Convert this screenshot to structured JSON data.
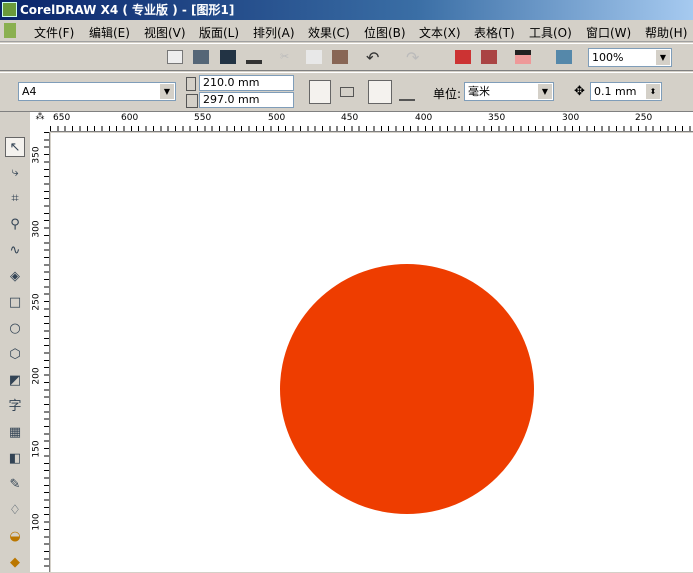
{
  "window": {
    "title": "CorelDRAW X4 ( 专业版 ) - [图形1]"
  },
  "menu": [
    "文件(F)",
    "编辑(E)",
    "视图(V)",
    "版面(L)",
    "排列(A)",
    "效果(C)",
    "位图(B)",
    "文本(X)",
    "表格(T)",
    "工具(O)",
    "窗口(W)",
    "帮助(H)"
  ],
  "toolbar": {
    "zoom": "100%",
    "icons": [
      "new-icon",
      "open-icon",
      "save-icon",
      "print-icon",
      "cut-icon",
      "copy-icon",
      "paste-icon",
      "undo-icon",
      "redo-icon",
      "import-icon",
      "export-icon",
      "application-launcher-icon",
      "welcome-screen-icon"
    ]
  },
  "property_bar": {
    "paper_size": "A4",
    "width": "210.0 mm",
    "height": "297.0 mm",
    "units_label": "单位:",
    "units": "毫米",
    "nudge": "0.1 mm"
  },
  "rulers": {
    "horizontal": [
      "650",
      "600",
      "550",
      "500",
      "450",
      "400",
      "350",
      "300",
      "250"
    ],
    "vertical": [
      "350",
      "300",
      "250",
      "200",
      "150",
      "100"
    ]
  },
  "tools": [
    "pick-tool",
    "shape-tool",
    "crop-tool",
    "zoom-tool",
    "freehand-tool",
    "smart-fill-tool",
    "rectangle-tool",
    "ellipse-tool",
    "polygon-tool",
    "basic-shapes-tool",
    "text-tool",
    "table-tool",
    "extrude-tool",
    "eyedropper-tool",
    "outline-tool",
    "fill-tool",
    "interactive-fill-tool"
  ],
  "text_tool_glyph": "字",
  "drawing": {
    "shape": "circle",
    "fill": "#ee3d00"
  }
}
